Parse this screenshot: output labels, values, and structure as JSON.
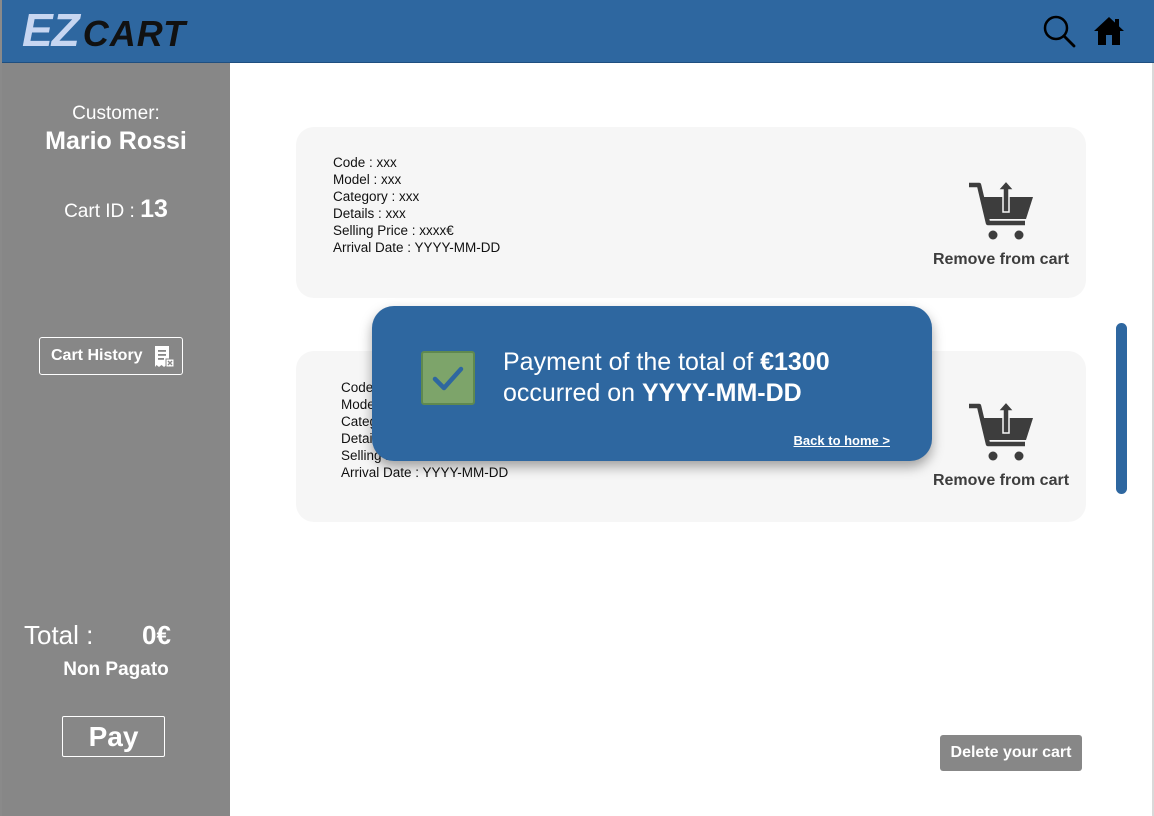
{
  "header": {
    "logo_ez": "EZ",
    "logo_cart": "CART",
    "icons": [
      "search-icon",
      "home-icon"
    ]
  },
  "sidebar": {
    "customer_label": "Customer:",
    "customer_name": "Mario Rossi",
    "cart_id_label": "Cart ID : ",
    "cart_id_value": "13",
    "history_button": "Cart History",
    "total_label": "Total :",
    "total_value": "0€",
    "payment_status": "Non Pagato",
    "pay_button": "Pay"
  },
  "cart_items": [
    {
      "lines": [
        "Code : xxx",
        "Model : xxx",
        "Category : xxx",
        "Details : xxx",
        "Selling Price : xxxx€",
        "Arrival Date : YYYY-MM-DD"
      ],
      "remove_label": "Remove from cart"
    },
    {
      "lines": [
        "Code : xxx",
        "Model : xxx",
        "Category : xxx",
        "Details : xxx",
        "Selling Price : xxxx€",
        "Arrival Date : YYYY-MM-DD"
      ],
      "remove_label": "Remove from cart"
    }
  ],
  "delete_button": "Delete your cart",
  "toast": {
    "line1_prefix": "Payment of the total of ",
    "line1_amount": "€1300",
    "line2_prefix": "occurred on ",
    "line2_date": "YYYY-MM-DD",
    "link": "Back to home >"
  },
  "colors": {
    "brand_blue": "#2e67a0",
    "sidebar_gray": "#878787",
    "check_green": "#7da46a"
  }
}
